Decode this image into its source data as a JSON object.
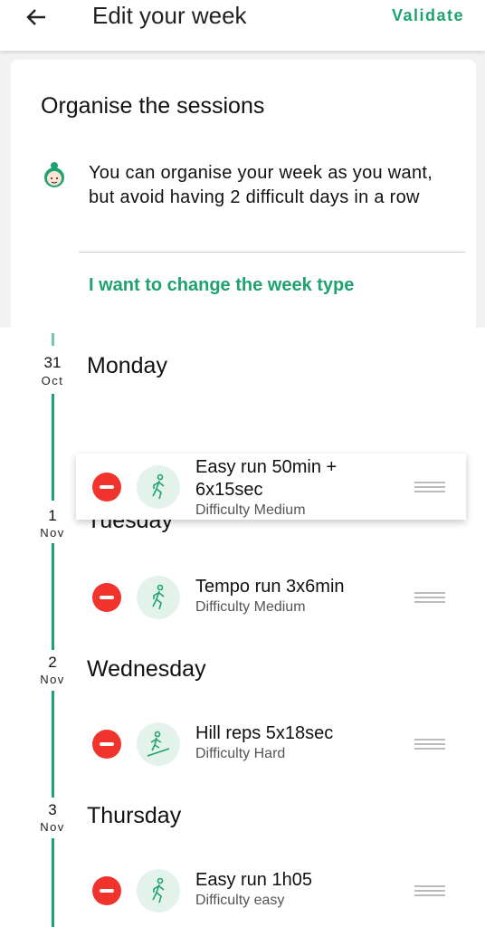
{
  "header": {
    "title": "Edit your week",
    "validate_label": "Validate",
    "back_icon": "arrow-left-icon"
  },
  "intro": {
    "title": "Organise the sessions",
    "message": "You can organise your week as you want, but avoid having 2 difficult days in a row",
    "link": "I want to change the week type",
    "avatar_icon": "coach-avatar-icon"
  },
  "colors": {
    "accent": "#1fa270",
    "remove": "#f0332d"
  },
  "days": [
    {
      "num": "31",
      "month": "Oct",
      "name": "Monday"
    },
    {
      "num": "1",
      "month": "Nov",
      "name": "Tuesday"
    },
    {
      "num": "2",
      "month": "Nov",
      "name": "Wednesday"
    },
    {
      "num": "3",
      "month": "Nov",
      "name": "Thursday"
    }
  ],
  "sessions": [
    {
      "title": "Easy run 50min + 6x15sec",
      "subtitle": "Difficulty Medium",
      "icon": "runner-icon",
      "state": "dragging"
    },
    {
      "title": "Tempo run 3x6min",
      "subtitle": "Difficulty Medium",
      "icon": "runner-icon"
    },
    {
      "title": "Hill reps 5x18sec",
      "subtitle": "Difficulty Hard",
      "icon": "hill-runner-icon"
    },
    {
      "title": "Easy run 1h05",
      "subtitle": "Difficulty easy",
      "icon": "runner-icon"
    }
  ]
}
